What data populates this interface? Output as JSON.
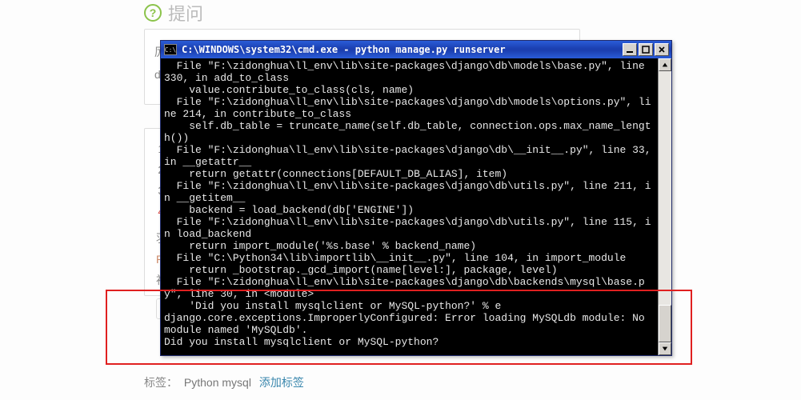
{
  "heading": "提问",
  "card1": {
    "line1": "厉",
    "line2": "d"
  },
  "ol_items": [
    "",
    "",
    "",
    ""
  ],
  "misc_rows": [
    "羽",
    "P",
    "衫"
  ],
  "attach_icon_label": "📎",
  "tags": {
    "label": "标签：",
    "values": "Python mysql",
    "add": "添加标签"
  },
  "cmd": {
    "title": "C:\\WINDOWS\\system32\\cmd.exe - python manage.py runserver",
    "output": "  File \"F:\\zidonghua\\ll_env\\lib\\site-packages\\django\\db\\models\\base.py\", line 330, in add_to_class\n    value.contribute_to_class(cls, name)\n  File \"F:\\zidonghua\\ll_env\\lib\\site-packages\\django\\db\\models\\options.py\", line 214, in contribute_to_class\n    self.db_table = truncate_name(self.db_table, connection.ops.max_name_length())\n  File \"F:\\zidonghua\\ll_env\\lib\\site-packages\\django\\db\\__init__.py\", line 33, in __getattr__\n    return getattr(connections[DEFAULT_DB_ALIAS], item)\n  File \"F:\\zidonghua\\ll_env\\lib\\site-packages\\django\\db\\utils.py\", line 211, in __getitem__\n    backend = load_backend(db['ENGINE'])\n  File \"F:\\zidonghua\\ll_env\\lib\\site-packages\\django\\db\\utils.py\", line 115, in load_backend\n    return import_module('%s.base' % backend_name)\n  File \"C:\\Python34\\lib\\importlib\\__init__.py\", line 104, in import_module\n    return _bootstrap._gcd_import(name[level:], package, level)\n  File \"F:\\zidonghua\\ll_env\\lib\\site-packages\\django\\db\\backends\\mysql\\base.py\", line 30, in <module>\n    'Did you install mysqlclient or MySQL-python?' % e\ndjango.core.exceptions.ImproperlyConfigured: Error loading MySQLdb module: No module named 'MySQLdb'.\nDid you install mysqlclient or MySQL-python?\n"
  }
}
